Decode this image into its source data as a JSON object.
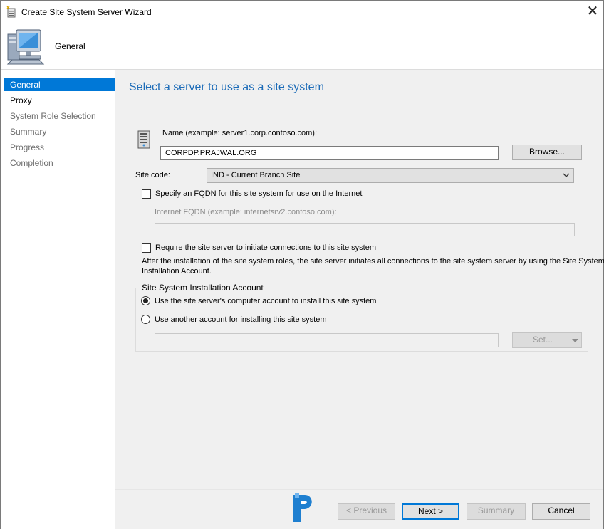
{
  "window": {
    "title": "Create Site System Server Wizard",
    "close_glyph": "✕"
  },
  "header": {
    "title": "General",
    "icon": "computer-icon"
  },
  "sidebar": {
    "items": [
      {
        "label": "General",
        "active": true
      },
      {
        "label": "Proxy"
      },
      {
        "label": "System Role Selection"
      },
      {
        "label": "Summary"
      },
      {
        "label": "Progress"
      },
      {
        "label": "Completion"
      }
    ]
  },
  "content": {
    "heading": "Select a server to use as a site system",
    "name_label": "Name (example: server1.corp.contoso.com):",
    "name_value": "CORPDP.PRAJWAL.ORG",
    "browse_label": "Browse...",
    "site_code_label": "Site code:",
    "site_code_value": "IND - Current Branch Site",
    "fqdn_checkbox_label": "Specify an FQDN for this site system for use on the Internet",
    "fqdn_checked": false,
    "internet_fqdn_label": "Internet FQDN (example: internetsrv2.contoso.com):",
    "internet_fqdn_value": "",
    "require_checkbox_label": "Require the site server to initiate connections to this site system",
    "require_checked": false,
    "info_line1": "After the  installation of the site system roles, the site server initiates all connections to the site system server by using the Site System",
    "info_line2": "Installation Account.",
    "account_group": {
      "title": "Site System Installation Account",
      "option1_label": "Use the site server's computer account to install this site system",
      "option2_label": "Use another account for installing this site system",
      "selected": "option1",
      "account_value": "",
      "set_label": "Set..."
    }
  },
  "footer": {
    "previous_label": "< Previous",
    "next_label": "Next >",
    "summary_label": "Summary",
    "cancel_label": "Cancel"
  },
  "colors": {
    "accent": "#0078d7",
    "heading": "#1d6cb8"
  }
}
